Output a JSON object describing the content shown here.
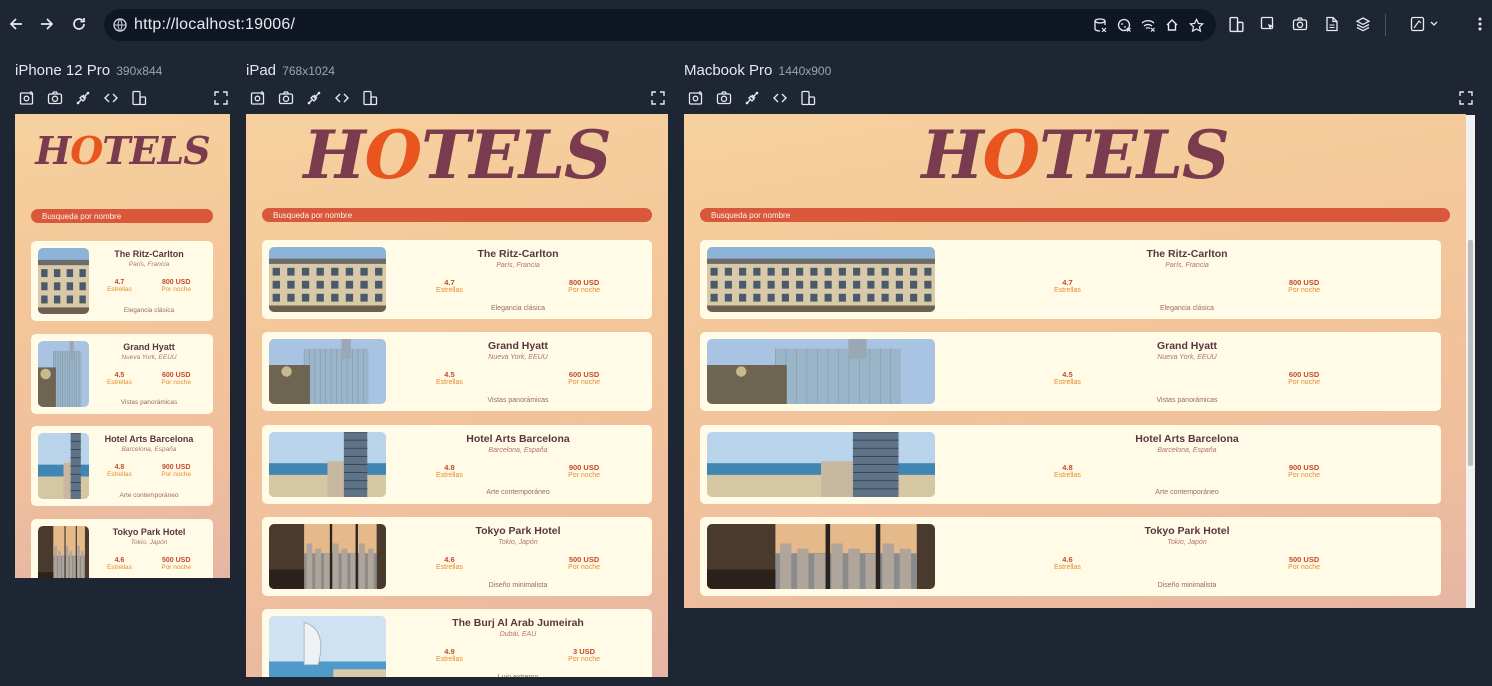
{
  "browser": {
    "url": "http://localhost:19006/"
  },
  "devices": [
    {
      "name": "iPhone 12 Pro",
      "dims": "390x844"
    },
    {
      "name": "iPad",
      "dims": "768x1024"
    },
    {
      "name": "Macbook Pro",
      "dims": "1440x900"
    }
  ],
  "app": {
    "logo": "HOTELS",
    "search_label": "Busqueda por nombre",
    "rating_label": "Estrellas",
    "price_label": "Por noche",
    "hotels": [
      {
        "name": "The Ritz-Carlton",
        "location": "París, Francia",
        "rating": "4.7",
        "price": "800 USD",
        "desc": "Elegancia clásica"
      },
      {
        "name": "Grand Hyatt",
        "location": "Nueva York, EEUU",
        "rating": "4.5",
        "price": "600 USD",
        "desc": "Vistas panorámicas"
      },
      {
        "name": "Hotel Arts Barcelona",
        "location": "Barcelona, España",
        "rating": "4.8",
        "price": "900 USD",
        "desc": "Arte contemporáneo"
      },
      {
        "name": "Tokyo Park Hotel",
        "location": "Tokio, Japón",
        "rating": "4.6",
        "price": "500 USD",
        "desc": "Diseño minimalista"
      },
      {
        "name": "The Burj Al Arab Jumeirah",
        "location": "Dubái, EAU",
        "rating": "4.9",
        "price": "3 USD",
        "desc": "Lujo extremo"
      }
    ]
  },
  "colors": {
    "page_bg": "#1e2633",
    "accent": "#d9573a",
    "card_bg": "#fffbe6",
    "title": "#5a3540"
  }
}
